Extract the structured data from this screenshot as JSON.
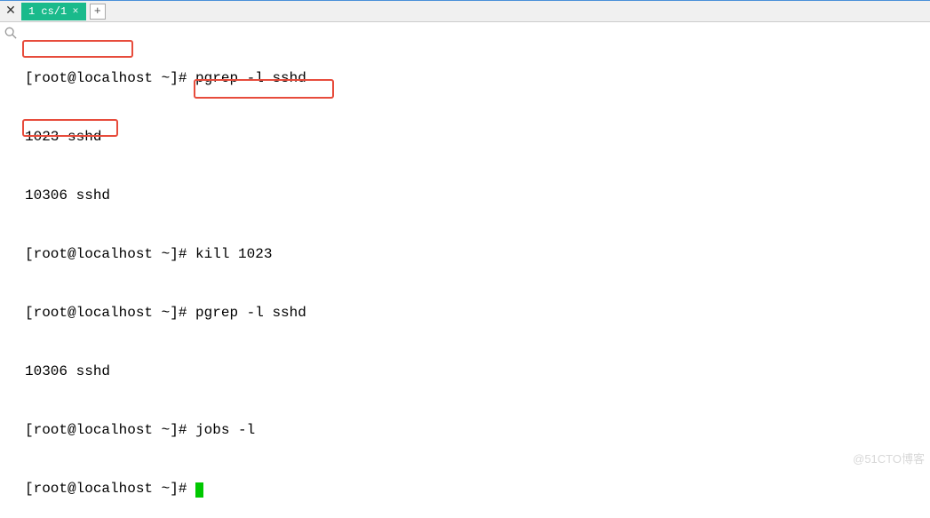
{
  "header": {
    "close_label": "✕",
    "tab_label": "1 cs/1",
    "tab_close": "✕",
    "add_tab": "+"
  },
  "prompt": "[root@localhost ~]# ",
  "lines": [
    {
      "prompt": true,
      "cmd": "pgrep -l sshd"
    },
    {
      "prompt": false,
      "cmd": "1023 sshd"
    },
    {
      "prompt": false,
      "cmd": "10306 sshd"
    },
    {
      "prompt": true,
      "cmd": "kill 1023"
    },
    {
      "prompt": true,
      "cmd": "pgrep -l sshd"
    },
    {
      "prompt": false,
      "cmd": "10306 sshd"
    },
    {
      "prompt": true,
      "cmd": "jobs -l"
    },
    {
      "prompt": true,
      "cmd": ""
    }
  ],
  "watermark": "@51CTO博客"
}
